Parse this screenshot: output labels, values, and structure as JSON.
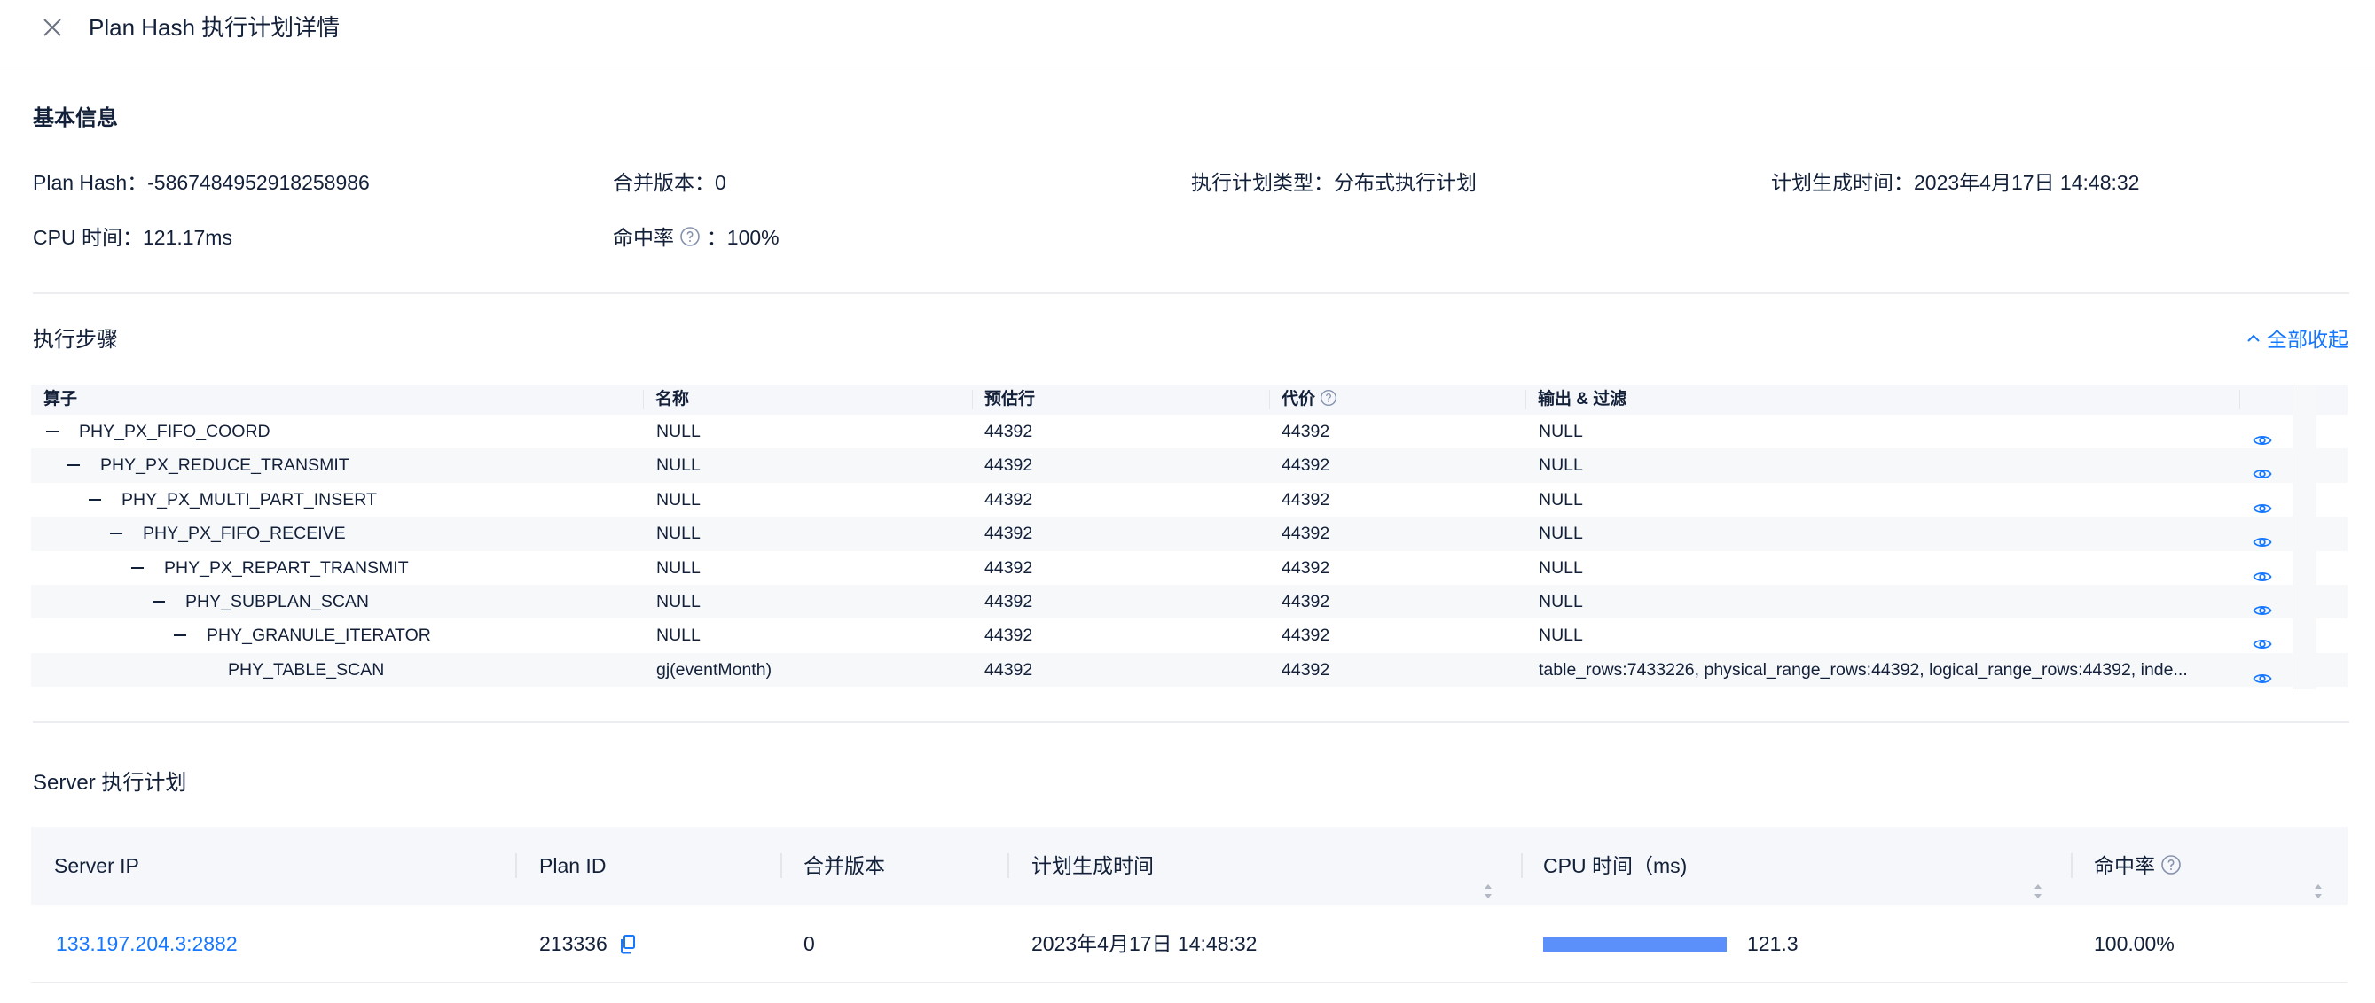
{
  "header": {
    "title": "Plan Hash 执行计划详情"
  },
  "basic_info": {
    "title": "基本信息",
    "plan_hash": "Plan Hash：-5867484952918258986",
    "merge_version": "合并版本：0",
    "plan_type": "执行计划类型：分布式执行计划",
    "gen_time": "计划生成时间：2023年4月17日 14:48:32",
    "cpu_time": "CPU 时间：121.17ms",
    "hit_rate_label": "命中率",
    "hit_rate_value": "：100%"
  },
  "steps": {
    "title": "执行步骤",
    "collapse_all": "全部收起",
    "columns": {
      "operator": "算子",
      "name": "名称",
      "est_rows": "预估行",
      "cost": "代价",
      "output": "输出 & 过滤"
    },
    "rows": [
      {
        "operator": "PHY_PX_FIFO_COORD",
        "name": "NULL",
        "est_rows": "44392",
        "cost": "44392",
        "output": "NULL",
        "depth": 0,
        "expanded": true
      },
      {
        "operator": "PHY_PX_REDUCE_TRANSMIT",
        "name": "NULL",
        "est_rows": "44392",
        "cost": "44392",
        "output": "NULL",
        "depth": 1,
        "expanded": true
      },
      {
        "operator": "PHY_PX_MULTI_PART_INSERT",
        "name": "NULL",
        "est_rows": "44392",
        "cost": "44392",
        "output": "NULL",
        "depth": 2,
        "expanded": true
      },
      {
        "operator": "PHY_PX_FIFO_RECEIVE",
        "name": "NULL",
        "est_rows": "44392",
        "cost": "44392",
        "output": "NULL",
        "depth": 3,
        "expanded": true
      },
      {
        "operator": "PHY_PX_REPART_TRANSMIT",
        "name": "NULL",
        "est_rows": "44392",
        "cost": "44392",
        "output": "NULL",
        "depth": 4,
        "expanded": true
      },
      {
        "operator": "PHY_SUBPLAN_SCAN",
        "name": "NULL",
        "est_rows": "44392",
        "cost": "44392",
        "output": "NULL",
        "depth": 5,
        "expanded": true
      },
      {
        "operator": "PHY_GRANULE_ITERATOR",
        "name": "NULL",
        "est_rows": "44392",
        "cost": "44392",
        "output": "NULL",
        "depth": 6,
        "expanded": true
      },
      {
        "operator": "PHY_TABLE_SCAN",
        "name": "gj(eventMonth)",
        "est_rows": "44392",
        "cost": "44392",
        "output": "table_rows:7433226, physical_range_rows:44392, logical_range_rows:44392, inde...",
        "depth": 7,
        "expanded": false
      }
    ]
  },
  "server": {
    "title": "Server 执行计划",
    "columns": {
      "ip": "Server IP",
      "plan_id": "Plan ID",
      "merge_version": "合并版本",
      "gen_time": "计划生成时间",
      "cpu_time": "CPU 时间（ms)",
      "hit_rate": "命中率"
    },
    "rows": [
      {
        "ip": "133.197.204.3:2882",
        "plan_id": "213336",
        "merge_version": "0",
        "gen_time": "2023年4月17日 14:48:32",
        "cpu_time": "121.3",
        "hit_rate": "100.00%"
      }
    ]
  },
  "colors": {
    "accent": "#1677ff",
    "bar": "#5b8ff9",
    "text": "#132039"
  }
}
